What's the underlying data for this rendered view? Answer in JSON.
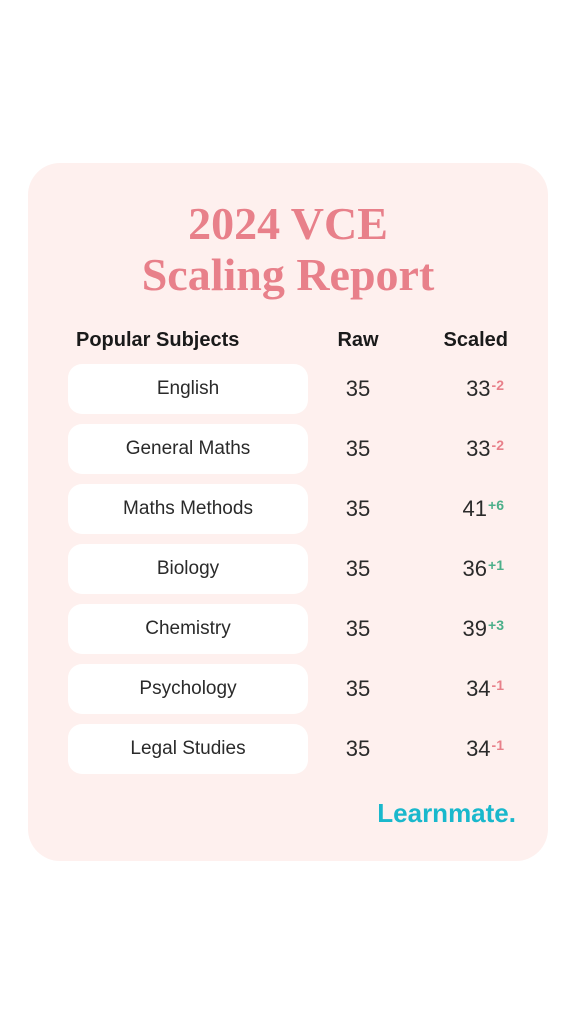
{
  "page": {
    "title_line1": "2024 VCE",
    "title_line2": "Scaling Report"
  },
  "table": {
    "headers": {
      "subject": "Popular Subjects",
      "raw": "Raw",
      "scaled": "Scaled"
    },
    "rows": [
      {
        "subject": "English",
        "raw": "35",
        "scaled": "33",
        "delta": "-2",
        "delta_type": "negative"
      },
      {
        "subject": "General Maths",
        "raw": "35",
        "scaled": "33",
        "delta": "-2",
        "delta_type": "negative"
      },
      {
        "subject": "Maths Methods",
        "raw": "35",
        "scaled": "41",
        "delta": "+6",
        "delta_type": "positive"
      },
      {
        "subject": "Biology",
        "raw": "35",
        "scaled": "36",
        "delta": "+1",
        "delta_type": "positive"
      },
      {
        "subject": "Chemistry",
        "raw": "35",
        "scaled": "39",
        "delta": "+3",
        "delta_type": "positive"
      },
      {
        "subject": "Psychology",
        "raw": "35",
        "scaled": "34",
        "delta": "-1",
        "delta_type": "negative"
      },
      {
        "subject": "Legal Studies",
        "raw": "35",
        "scaled": "34",
        "delta": "-1",
        "delta_type": "negative"
      }
    ]
  },
  "branding": "Learnmate."
}
